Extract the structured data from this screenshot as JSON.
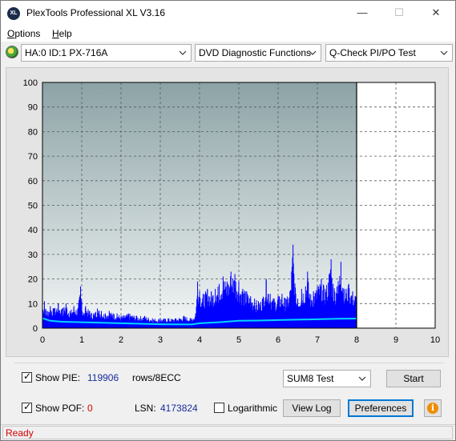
{
  "window": {
    "title": "PlexTools Professional XL V3.16",
    "icon_text": "XL",
    "controls": {
      "minimize": "—",
      "maximize": "☐",
      "close": "✕"
    }
  },
  "menu": [
    {
      "label": "Options",
      "underline": "O"
    },
    {
      "label": "Help",
      "underline": "H"
    }
  ],
  "toolbar": {
    "drive": "HA:0 ID:1  PX-716A",
    "function": "DVD Diagnostic Functions",
    "test": "Q-Check PI/PO Test"
  },
  "chart_data": {
    "type": "area",
    "xlim": [
      0,
      10
    ],
    "ylim": [
      0,
      100
    ],
    "x_ticks": [
      "0",
      "1",
      "2",
      "3",
      "4",
      "5",
      "6",
      "7",
      "8",
      "9",
      "10"
    ],
    "y_ticks": [
      "0",
      "10",
      "20",
      "30",
      "40",
      "50",
      "60",
      "70",
      "80",
      "90",
      "100"
    ],
    "data_end_x": 8.0,
    "grid": true,
    "series": [
      {
        "kind": "pie-bars",
        "color": "#0000ff",
        "points": [
          [
            0.0,
            9
          ],
          [
            0.05,
            11
          ],
          [
            0.1,
            7
          ],
          [
            0.2,
            9
          ],
          [
            0.3,
            8
          ],
          [
            0.4,
            10
          ],
          [
            0.5,
            8
          ],
          [
            0.6,
            10
          ],
          [
            0.7,
            7
          ],
          [
            0.8,
            9
          ],
          [
            0.9,
            8
          ],
          [
            0.97,
            17
          ],
          [
            1.0,
            11
          ],
          [
            1.05,
            6
          ],
          [
            1.1,
            9
          ],
          [
            1.2,
            7
          ],
          [
            1.3,
            6
          ],
          [
            1.4,
            8
          ],
          [
            1.5,
            7
          ],
          [
            1.6,
            6
          ],
          [
            1.7,
            7
          ],
          [
            1.8,
            6
          ],
          [
            1.9,
            6
          ],
          [
            2.0,
            5
          ],
          [
            2.2,
            6
          ],
          [
            2.4,
            5
          ],
          [
            2.6,
            5
          ],
          [
            2.8,
            4
          ],
          [
            3.0,
            4
          ],
          [
            3.2,
            4
          ],
          [
            3.4,
            4
          ],
          [
            3.6,
            5
          ],
          [
            3.8,
            4
          ],
          [
            3.9,
            6
          ],
          [
            3.95,
            19
          ],
          [
            4.0,
            15
          ],
          [
            4.1,
            14
          ],
          [
            4.2,
            16
          ],
          [
            4.3,
            15
          ],
          [
            4.4,
            16
          ],
          [
            4.5,
            18
          ],
          [
            4.6,
            21
          ],
          [
            4.7,
            19
          ],
          [
            4.8,
            23
          ],
          [
            4.9,
            22
          ],
          [
            5.0,
            19
          ],
          [
            5.1,
            16
          ],
          [
            5.2,
            15
          ],
          [
            5.3,
            13
          ],
          [
            5.4,
            12
          ],
          [
            5.5,
            11
          ],
          [
            5.6,
            12
          ],
          [
            5.7,
            20
          ],
          [
            5.8,
            14
          ],
          [
            5.9,
            12
          ],
          [
            6.0,
            13
          ],
          [
            6.1,
            14
          ],
          [
            6.2,
            12
          ],
          [
            6.3,
            15
          ],
          [
            6.38,
            34
          ],
          [
            6.45,
            14
          ],
          [
            6.5,
            12
          ],
          [
            6.6,
            16
          ],
          [
            6.7,
            17
          ],
          [
            6.75,
            23
          ],
          [
            6.8,
            14
          ],
          [
            6.9,
            15
          ],
          [
            7.0,
            17
          ],
          [
            7.1,
            20
          ],
          [
            7.2,
            16
          ],
          [
            7.3,
            22
          ],
          [
            7.35,
            28
          ],
          [
            7.4,
            18
          ],
          [
            7.5,
            17
          ],
          [
            7.6,
            27
          ],
          [
            7.7,
            16
          ],
          [
            7.8,
            18
          ],
          [
            7.9,
            15
          ],
          [
            8.0,
            14
          ]
        ]
      },
      {
        "kind": "avg-line",
        "color": "#00d7ff",
        "points": [
          [
            0.0,
            4.0
          ],
          [
            0.2,
            3.0
          ],
          [
            0.5,
            2.6
          ],
          [
            1.0,
            2.4
          ],
          [
            2.0,
            2.0
          ],
          [
            3.0,
            1.6
          ],
          [
            3.8,
            1.5
          ],
          [
            4.0,
            2.0
          ],
          [
            4.5,
            2.4
          ],
          [
            5.0,
            3.0
          ],
          [
            5.5,
            3.1
          ],
          [
            6.0,
            3.3
          ],
          [
            7.0,
            3.6
          ],
          [
            7.5,
            3.8
          ],
          [
            8.0,
            3.9
          ]
        ]
      }
    ]
  },
  "panel": {
    "show_pie_label": "Show PIE:",
    "pie_value": "119906",
    "pie_unit": "rows/8ECC",
    "show_pof_label": "Show POF:",
    "pof_value": "0",
    "lsn_label": "LSN:",
    "lsn_value": "4173824",
    "logarithmic_label": "Logarithmic",
    "sum_select": "SUM8 Test",
    "start_label": "Start",
    "view_log_label": "View Log",
    "preferences_label": "Preferences",
    "info_glyph": "i",
    "show_pie_checked": true,
    "show_pof_checked": true,
    "logarithmic_checked": false
  },
  "status": {
    "text": "Ready"
  },
  "colors": {
    "plot_top": "#8ca3a6",
    "plot_bottom": "#f3f6f6",
    "pie": "#0000ff",
    "avg": "#00d7ff",
    "status_text": "#d40000"
  }
}
